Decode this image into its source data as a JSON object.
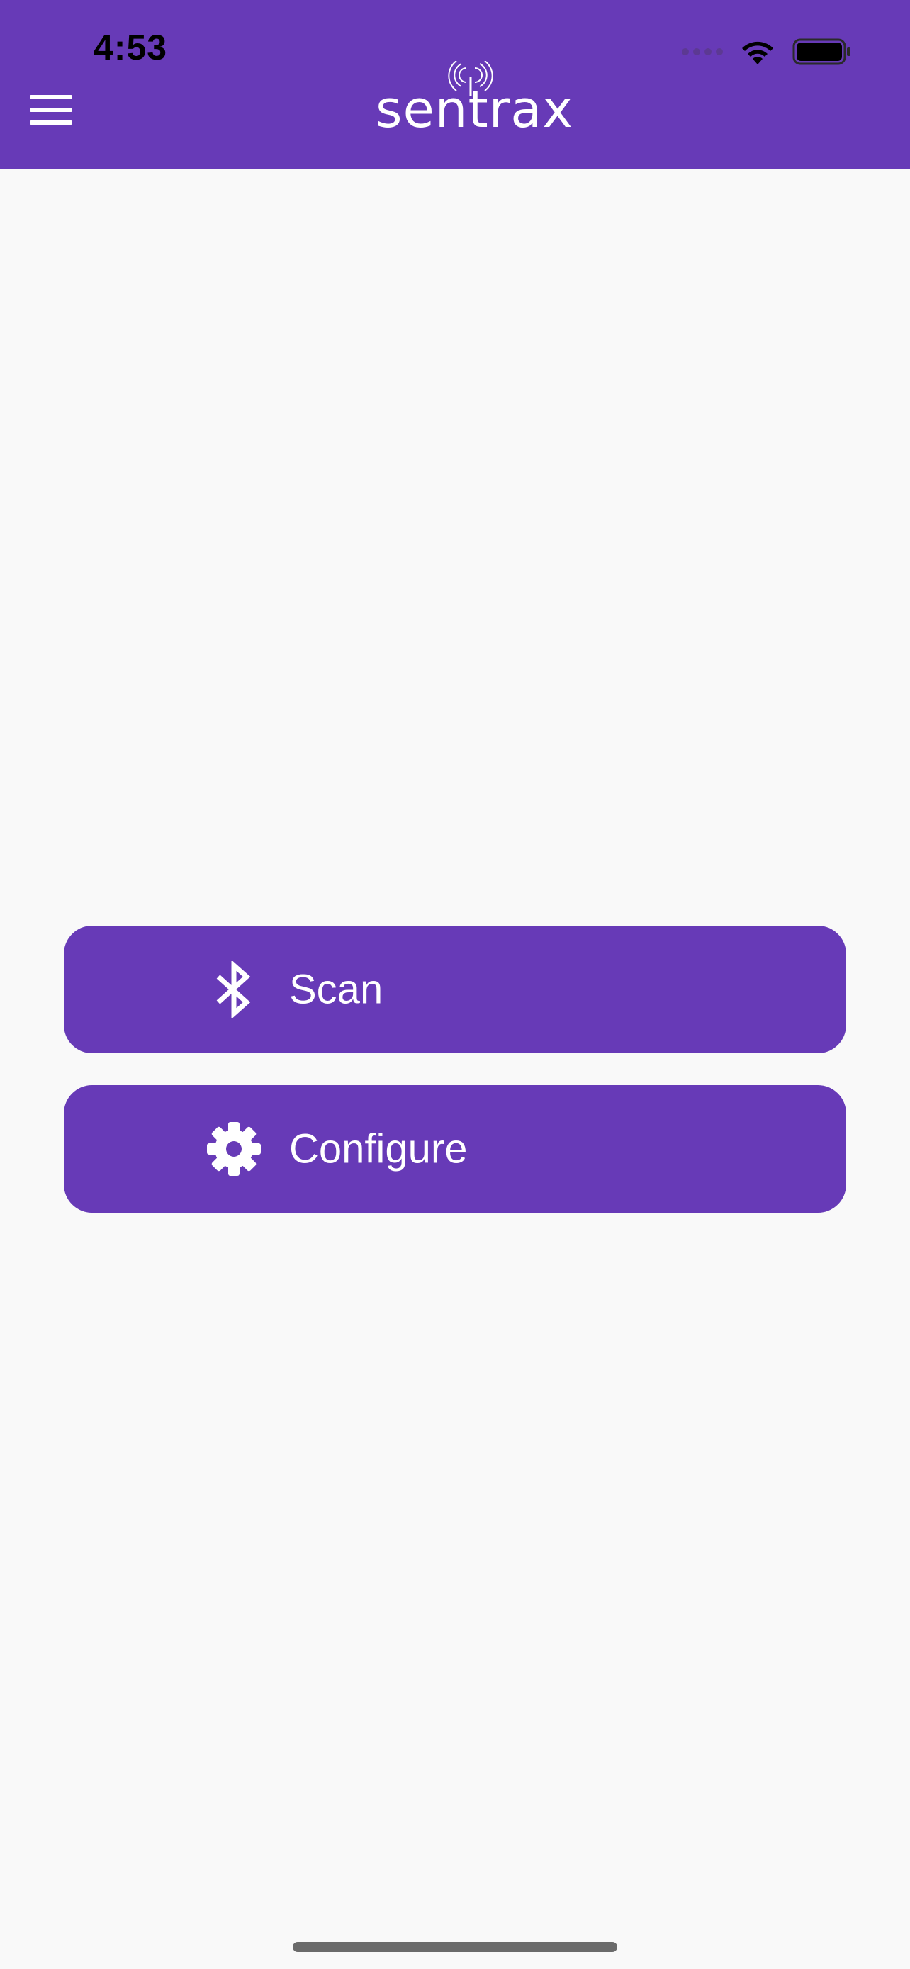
{
  "status_bar": {
    "time": "4:53",
    "icons": [
      "signal-dots-icon",
      "wifi-icon",
      "battery-icon"
    ]
  },
  "header": {
    "background": "#673ab7",
    "menu_icon": "hamburger-menu-icon",
    "logo_text": "sentrax"
  },
  "actions": [
    {
      "label": "Scan",
      "icon": "bluetooth-icon"
    },
    {
      "label": "Configure",
      "icon": "gear-icon"
    }
  ],
  "colors": {
    "primary": "#673ab7",
    "background": "#f9f9f9",
    "on_primary": "#ffffff"
  }
}
